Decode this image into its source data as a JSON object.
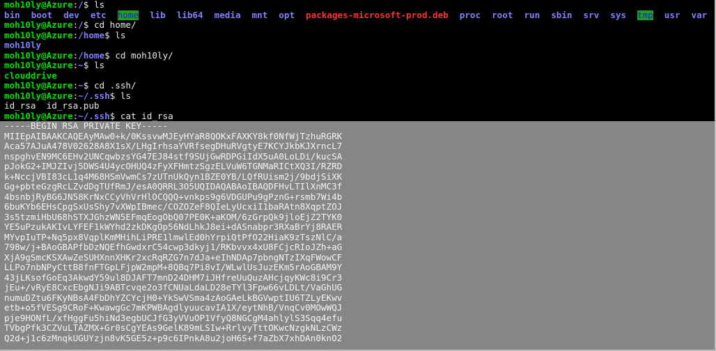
{
  "terminal": {
    "prompt_user": "moh10ly@Azure",
    "lines": {
      "l1": {
        "path": "/",
        "cmd": "ls"
      },
      "l3": {
        "path": "/",
        "cmd": "cd home/"
      },
      "l4": {
        "path": "/home",
        "cmd": "ls"
      },
      "l6": {
        "path": "/home",
        "cmd": "cd moh10ly/"
      },
      "l7": {
        "path": "~",
        "cmd": "ls"
      },
      "l9": {
        "path": "~",
        "cmd": "cd .ssh/"
      },
      "l10": {
        "path": "~/.ssh",
        "cmd": "ls"
      },
      "l12": {
        "path": "~/.ssh",
        "cmd": "cat id_rsa"
      }
    },
    "root_listing": [
      {
        "name": "bin",
        "kind": "dir"
      },
      {
        "name": "boot",
        "kind": "dir"
      },
      {
        "name": "dev",
        "kind": "dir"
      },
      {
        "name": "etc",
        "kind": "dir"
      },
      {
        "name": "home",
        "kind": "hl"
      },
      {
        "name": "lib",
        "kind": "dir"
      },
      {
        "name": "lib64",
        "kind": "dir"
      },
      {
        "name": "media",
        "kind": "dir"
      },
      {
        "name": "mnt",
        "kind": "dir"
      },
      {
        "name": "opt",
        "kind": "dir"
      },
      {
        "name": "packages-microsoft-prod.deb",
        "kind": "arch"
      },
      {
        "name": "proc",
        "kind": "dir"
      },
      {
        "name": "root",
        "kind": "dir"
      },
      {
        "name": "run",
        "kind": "dir"
      },
      {
        "name": "sbin",
        "kind": "dir"
      },
      {
        "name": "srv",
        "kind": "dir"
      },
      {
        "name": "sys",
        "kind": "dir"
      },
      {
        "name": "tmp",
        "kind": "hl"
      },
      {
        "name": "usr",
        "kind": "dir"
      },
      {
        "name": "var",
        "kind": "dir"
      }
    ],
    "home_listing": "moh10ly",
    "user_listing": "clouddrive",
    "ssh_listing": "id_rsa  id_rsa.pub",
    "key_lines": [
      "-----BEGIN RSA PRIVATE KEY-----",
      "MIIEpAIBAAKCAQEAyMAw0+k/0KssvwMJEyHYaR8QOKxFAXKY8kf0NfWjTzhuRGRK",
      "Aca57AJuA478V02628A8X1sX/LHgIrhsaYVRfsegDHuRVgtyE7KCYJkbKJXrncL7",
      "nspghvEN9MC6EHv2UNCqwbzsYG47EJ84stf9SUjGwRDPGiIdX5uA0LoLDi/kucSA",
      "pJokG2+IMJZIvj5DWS4U4ycOHUQ4zFyXFHmtzSgzELVuW6TGNMaRICtXQ3I/RZRD",
      "k+NccjVBI83cL1q4M68HSmVwmCs7zUTnUkQyn1BZE0YB/LQfRUism2j/9bdjSiXK",
      "Gg+pbteGzgRcLZvdDgTUfRmJ/esA0QRRL3O5UQIDAQABAoIBAQDFHvLTIlXnMC3f",
      "4bsnbjRyBG6JN58KrNxCCyVhVrHlOCQQQ+vnkps9g6VDGUPu9gPznG+rsmb7Wi4b",
      "6buKYb6EHsCpgSxUsShy7vXWpIBmec/COZOZeF8QIeLyUcxiI1baRAtn8XqptZOJ",
      "3s5tzmiHbU68hSTXJGhzWN5EFmqEogObQ07PE0K+aKOM/6zGrpQk9jloEjZ2TYK0",
      "YE5uPzukAKIvLYFEF1kWYhd2zkDKgOp56NdLhkJ8ei+dASnabpr3RXaBrYj8RAER",
      "MYvpIuTP+Nq5px8VqplKmMHihLiPRE1lmwlEd0hYrpiQtPfO22HiaK9zTszNlC/a",
      "798w/j+BAoGBAPfbDzNQEfhGwdxrC54cwp3dkyj1/RKbvvx4xU8FCjcRIoJZh+aG",
      "XjA9gSmcKSXAwZeSUHXnnXHKr2xcRqRZG7n7dJa+eIhNDAp7pbngNTzIXqFWowCF",
      "LLPo7nbNPyCttB8fnFTGpLFjpW2mpM+8QBq7Pi8vI/WLwlUsJuzEKm5rAoGBAM9Y",
      "43jLKsofGoEq3AkwdY59ul8DJAFT7mnD24DHM7iJHfreUuQuzAHcjqyKWc8i9Cr3",
      "jEu+/vRyE8CxcEbgNJi9ABTcvqe2o3fCNUaLdaLD28eTYl3Fpw66vLDLt/VaGhUG",
      "numuDZtu6FKyNBsA4FbDhYZCYcjH0+YkSwVSma4zAoGAeLkBGVwptIU6TZLyEKwv",
      "etb+o5fVESg9CRoF+KwawgGc7mKPWBAgdlyuucavIA1X/eytNhB/VnqCv0MOwWQJ",
      "pje9HONfL/xfHggFu5hiNd3egbUCJfG3yVVuOP1VfyQ8NGCgM4ahlylS3Sqq4efu",
      "TVbgPfk3CZVuLTAZMX+Gr0sCgYEAs9GelK89mLSIw+RrlvyTttOKwcNzgkNLzCWz",
      "Q2d+j1c6zMnqkUGUYzjn8vK5GE5z+p9c6IPnkA8u2joH6S+f7aZbX7xhDAn0knO2"
    ]
  }
}
